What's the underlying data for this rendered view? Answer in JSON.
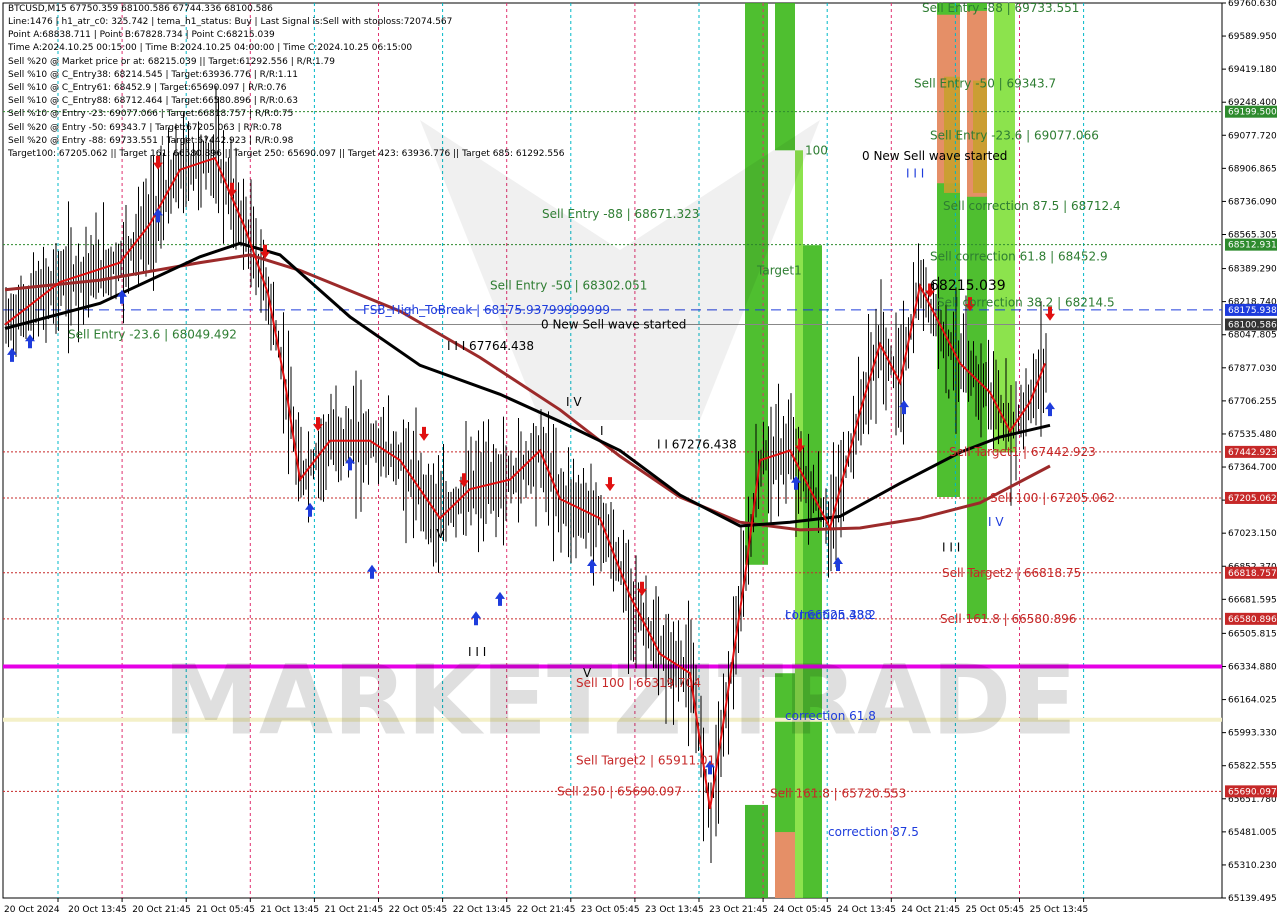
{
  "header": {
    "symbol_line": "BTCUSD,M15  67750.359 68100.586 67744.336 68100.586",
    "info_lines": [
      "Line:1476 | h1_atr_c0: 325.742 | tema_h1_status: Buy | Last Signal is:Sell with stoploss:72074.567",
      "Point A:68838.711 | Point B:67828.734 | Point C:68215.039",
      "Time A:2024.10.25 00:15:00 | Time B:2024.10.25 04:00:00 | Time C:2024.10.25 06:15:00",
      "Sell %20 @ Market price or at: 68215.039 || Target:61292.556 | R/R:1.79",
      "Sell %10 @ C_Entry38: 68214.545 | Target:63936.776 | R/R:1.11",
      "Sell %10 @ C_Entry61: 68452.9 | Target:65690.097 | R/R:0.76",
      "Sell %10 @ C_Entry88: 68712.464 | Target:66580.896 | R/R:0.63",
      "Sell %10 @ Entry -23: 69077.066 | Target:66818.757 | R/R:0.75",
      "Sell %20 @ Entry -50: 69343.7 | Target:67205.063 | R/R:0.78",
      "Sell %20 @ Entry -88: 69733.551 | Target:67442.923 | R/R:0.98",
      "Target100: 67205.062 || Target 161: 66580.896 || Target 250: 65690.097 || Target 423: 63936.776 || Target 685: 61292.556"
    ]
  },
  "watermark": "MARKETZITRADE",
  "chart_data": {
    "type": "candlestick",
    "symbol": "BTCUSD",
    "timeframe": "M15",
    "ylim": [
      65139.495,
      69760.63
    ],
    "price_ticks": [
      "69760.630",
      "69589.950",
      "69419.180",
      "69248.400",
      "69077.720",
      "68906.865",
      "68736.090",
      "68565.305",
      "68389.290",
      "68218.740",
      "68047.805",
      "67877.030",
      "67706.255",
      "67535.480",
      "67364.700",
      "67193.925",
      "67023.150",
      "66852.370",
      "66681.595",
      "66505.815",
      "66334.880",
      "66164.025",
      "65993.330",
      "65822.555",
      "65651.780",
      "65481.005",
      "65310.230",
      "65139.495"
    ],
    "time_labels": [
      "20 Oct 2024",
      "20 Oct 13:45",
      "20 Oct 21:45",
      "21 Oct 05:45",
      "21 Oct 13:45",
      "21 Oct 21:45",
      "22 Oct 05:45",
      "22 Oct 13:45",
      "22 Oct 21:45",
      "23 Oct 05:45",
      "23 Oct 13:45",
      "23 Oct 21:45",
      "24 Oct 05:45",
      "24 Oct 13:45",
      "24 Oct 21:45",
      "25 Oct 05:45",
      "25 Oct 13:45"
    ],
    "right_badges": [
      {
        "price": 69199.5,
        "label": "69199.500",
        "color": "#2e8b2e"
      },
      {
        "price": 68512.931,
        "label": "68512.931",
        "color": "#2e8b2e"
      },
      {
        "price": 68175.938,
        "label": "68175.938",
        "color": "#1e3cdc"
      },
      {
        "price": 68100.586,
        "label": "68100.586",
        "color": "#333333"
      },
      {
        "price": 67442.923,
        "label": "67442.923",
        "color": "#c62828"
      },
      {
        "price": 67205.062,
        "label": "67205.062",
        "color": "#c62828"
      },
      {
        "price": 66818.757,
        "label": "66818.757",
        "color": "#c62828"
      },
      {
        "price": 66580.896,
        "label": "66580.896",
        "color": "#c62828"
      },
      {
        "price": 65690.097,
        "label": "65690.097",
        "color": "#c62828"
      }
    ],
    "hlines": [
      {
        "price": 69199.5,
        "color": "#2e8b2e",
        "style": "dotted"
      },
      {
        "price": 68512.931,
        "color": "#2e8b2e",
        "style": "dotted"
      },
      {
        "price": 68175.938,
        "color": "#1e3cdc",
        "style": "dashed"
      },
      {
        "price": 68100.586,
        "color": "#888888",
        "style": "solid"
      },
      {
        "price": 67442.923,
        "color": "#c62828",
        "style": "dotted"
      },
      {
        "price": 67205.062,
        "color": "#c62828",
        "style": "dotted"
      },
      {
        "price": 66818.757,
        "color": "#c62828",
        "style": "dotted"
      },
      {
        "price": 66580.896,
        "color": "#c62828",
        "style": "dotted"
      },
      {
        "price": 65690.097,
        "color": "#c62828",
        "style": "dotted"
      },
      {
        "price": 66334.88,
        "color": "#e600e6",
        "style": "thick"
      },
      {
        "price": 66060.0,
        "color": "#f4f0c8",
        "style": "thick"
      }
    ],
    "annotations": [
      {
        "text": "Sell Entry -88 | 69733.551",
        "price": 69733.551,
        "color": "#2e7d32"
      },
      {
        "text": "Sell Entry -50 | 69343.7",
        "price": 69343.7,
        "color": "#2e7d32"
      },
      {
        "text": "0 New Sell wave started",
        "price": 68970.0,
        "color": "#000000"
      },
      {
        "text": "I I I",
        "price": 68880.0,
        "color": "#1e3cdc"
      },
      {
        "text": "Sell Entry -23.6 | 69077.066",
        "price": 69077.066,
        "color": "#2e7d32"
      },
      {
        "text": "Sell correction 87.5 | 68712.4",
        "price": 68712.4,
        "color": "#2e7d32"
      },
      {
        "text": "68215.039",
        "price": 68300.0,
        "color": "#000000"
      },
      {
        "text": "Sell correction 61.8 | 68452.9",
        "price": 68452.9,
        "color": "#2e7d32"
      },
      {
        "text": "Sell correction 38.2 | 68214.5",
        "price": 68214.5,
        "color": "#2e7d32"
      },
      {
        "text": "Sell Target1 | 67442.923",
        "price": 67442.923,
        "color": "#c62828"
      },
      {
        "text": "Sell 100 | 67205.062",
        "price": 67205.062,
        "color": "#c62828"
      },
      {
        "text": "I V",
        "price": 67080.0,
        "color": "#1e3cdc"
      },
      {
        "text": "I I I",
        "price": 66950.0,
        "color": "#000000"
      },
      {
        "text": "Sell Target2 | 66818.75",
        "price": 66818.75,
        "color": "#c62828"
      },
      {
        "text": "Sell 161.8 | 66580.896",
        "price": 66580.896,
        "color": "#c62828"
      },
      {
        "text": "Sell 250 | 65690.097",
        "price": 65690.097,
        "color": "#c62828"
      },
      {
        "text": "Sell Entry -88 | 68671.323",
        "price": 68671.323,
        "color": "#2e7d32"
      },
      {
        "text": "Sell Entry -50 | 68302.051",
        "price": 68302.051,
        "color": "#2e7d32"
      },
      {
        "text": "0 New Sell wave started",
        "price": 68100.0,
        "color": "#000000"
      },
      {
        "text": "Sell Entry -23.6 | 68049.492",
        "price": 68049.492,
        "color": "#2e7d32"
      },
      {
        "text": "FSB_High_ToBreak | 68175.93799999999",
        "price": 68175.938,
        "color": "#1e3cdc"
      },
      {
        "text": "I I I 67764.438",
        "price": 67990.0,
        "color": "#000000"
      },
      {
        "text": "I V",
        "price": 67700.0,
        "color": "#000000"
      },
      {
        "text": "I I 67276.438",
        "price": 67480.0,
        "color": "#000000"
      },
      {
        "text": "I V",
        "price": 67020.0,
        "color": "#000000"
      },
      {
        "text": "I I I",
        "price": 66410.0,
        "color": "#000000"
      },
      {
        "text": "V",
        "price": 66300.0,
        "color": "#000000"
      },
      {
        "text": "Sell 100 | 66319.704",
        "price": 66250.0,
        "color": "#c62828"
      },
      {
        "text": "Sell Target2 | 65911.01",
        "price": 65850.0,
        "color": "#c62828"
      },
      {
        "text": "Sell 161.8 | 65720.553",
        "price": 65680.0,
        "color": "#c62828"
      },
      {
        "text": "I I I 66625.438",
        "price": 66600.0,
        "color": "#1e3cdc"
      },
      {
        "text": "correction 38.2",
        "price": 66600.0,
        "color": "#1e3cdc"
      },
      {
        "text": "correction 61.8",
        "price": 66080.0,
        "color": "#1e3cdc"
      },
      {
        "text": "correction 87.5",
        "price": 65480.0,
        "color": "#1e3cdc"
      },
      {
        "text": "100",
        "price": 69000.0,
        "color": "#2e7d32"
      },
      {
        "text": "Target1",
        "price": 68380.0,
        "color": "#2e7d32"
      },
      {
        "text": "I",
        "price": 67740.0,
        "color": "#000000"
      },
      {
        "text": "I",
        "price": 67550.0,
        "color": "#000000"
      }
    ]
  }
}
